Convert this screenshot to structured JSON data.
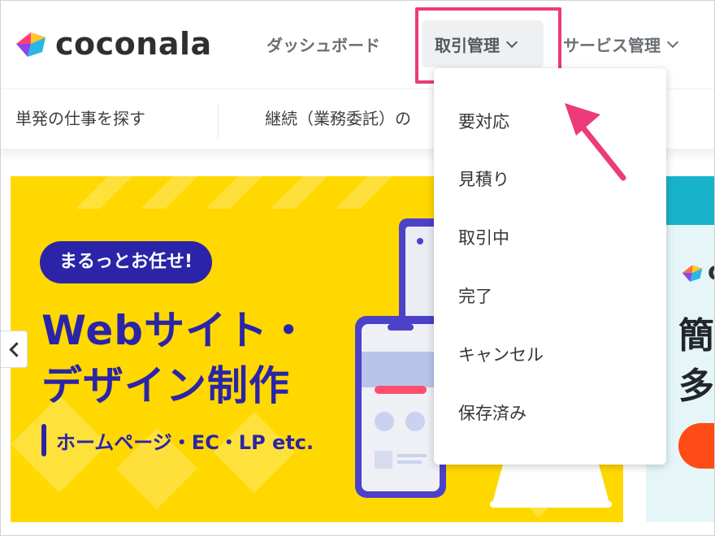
{
  "brand": {
    "name": "coconala"
  },
  "nav": {
    "dashboard": "ダッシュボード",
    "trade": "取引管理",
    "service": "サービス管理"
  },
  "subnav": {
    "find_jobs": "単発の仕事を探す",
    "continuous": "継続（業務委託）の"
  },
  "dropdown": {
    "items": [
      "要対応",
      "見積り",
      "取引中",
      "完了",
      "キャンセル",
      "保存済み"
    ]
  },
  "banner": {
    "pill": "まるっとお任せ!",
    "headline_1": "Webサイト・",
    "headline_2": "デザイン制作",
    "sub": "ホームページ・EC・LP etc."
  },
  "banner2": {
    "line_1": "簡",
    "line_2": "多",
    "logo_letter": "c"
  },
  "colors": {
    "highlight": "#ec3a7a",
    "banner_bg": "#ffd800",
    "banner_ink": "#2b24a8",
    "accent_cta": "#ff4b16",
    "teal": "#19b3c9"
  },
  "icons": [
    "coconala-logo-icon",
    "chevron-down-icon",
    "chevron-left-icon",
    "pointer-arrow-icon"
  ]
}
